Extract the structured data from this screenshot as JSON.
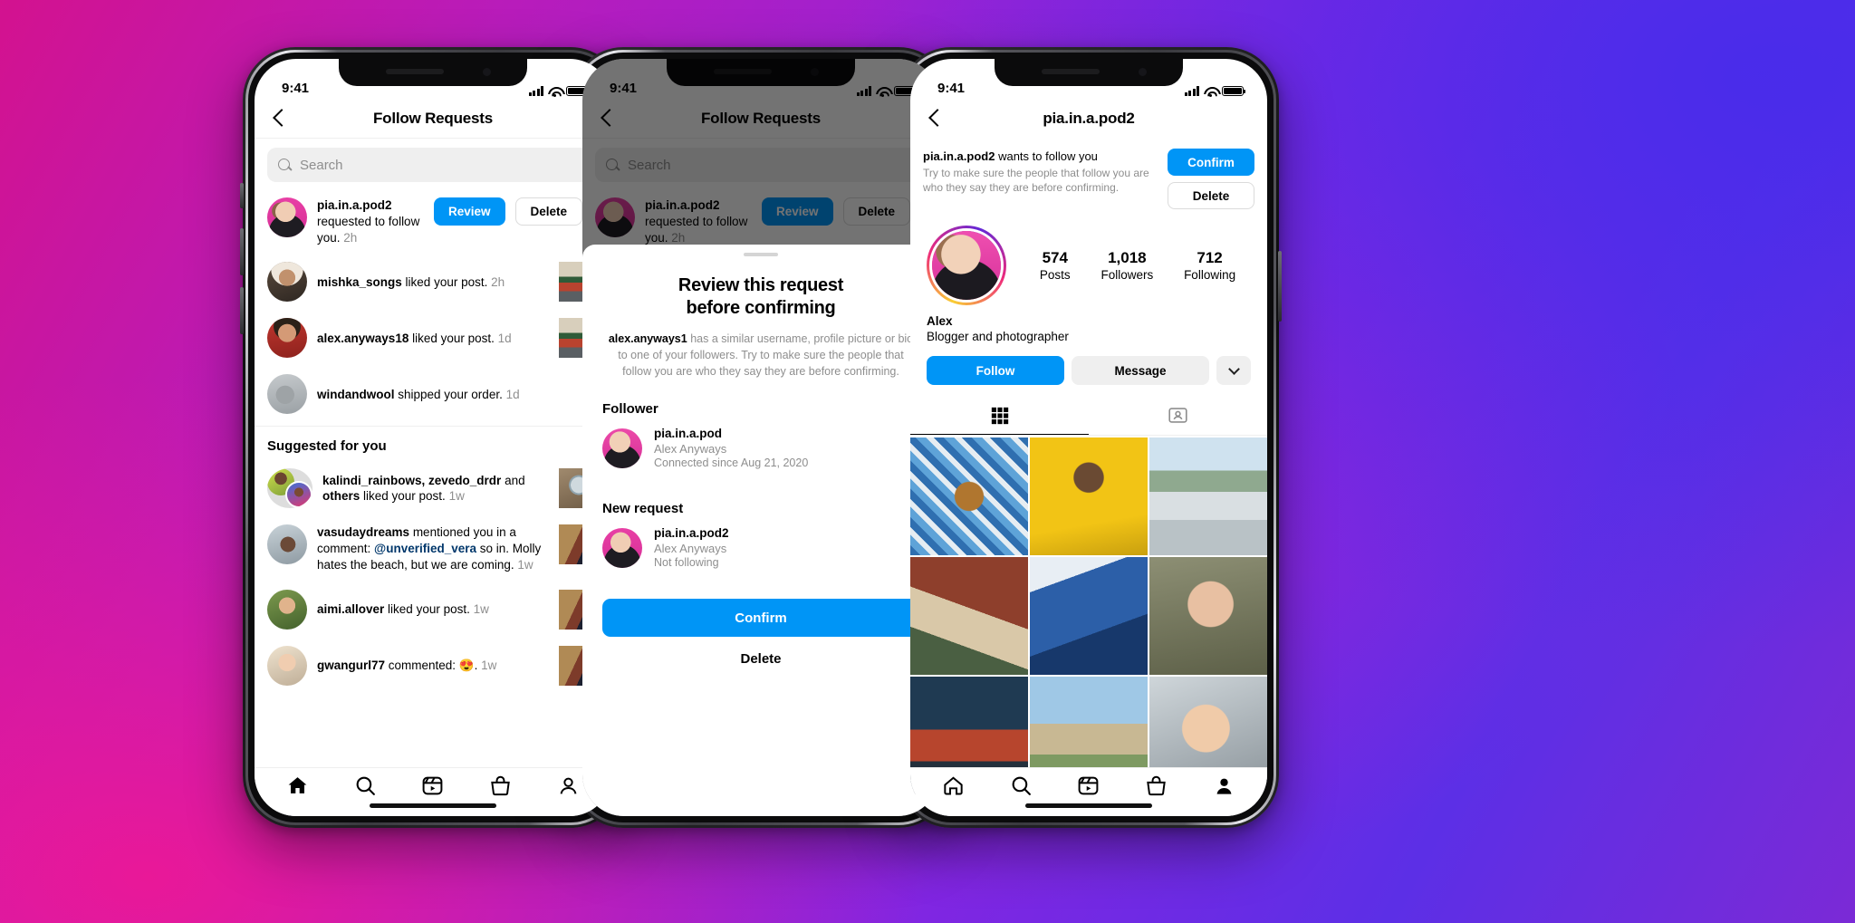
{
  "phones": [
    {
      "id": "phone-follow-requests",
      "status": {
        "time": "9:41"
      },
      "nav": {
        "title": "Follow Requests",
        "back_icon": "chevron-left-icon"
      },
      "search": {
        "placeholder": "Search",
        "icon": "search-icon"
      },
      "notifications": [
        {
          "user": "pia.in.a.pod2",
          "text": " requested to follow you.",
          "time": "2h",
          "actions": {
            "primary": "Review",
            "secondary": "Delete"
          },
          "avatar": "pia-avatar",
          "multiline": true
        },
        {
          "user": "mishka_songs",
          "text": " liked your post.",
          "time": "2h",
          "thumb": "post-thumb-storefront",
          "avatar": "mishka-avatar"
        },
        {
          "user": "alex.anyways18",
          "text": " liked your post.",
          "time": "1d",
          "thumb": "post-thumb-storefront",
          "avatar": "alex-avatar"
        },
        {
          "user": "windandwool",
          "text": " shipped your order.",
          "time": "1d",
          "avatar": "windandwool-avatar"
        }
      ],
      "section_title": "Suggested for you",
      "suggested": [
        {
          "user": "kalindi_rainbows, zevedo_drdr",
          "mid": " and ",
          "user2": "others",
          "text": " liked your post.",
          "time": "1w",
          "thumb": "post-thumb-ceramic",
          "avatar": "kalindi-avatar-pair"
        },
        {
          "user": "vasudaydreams",
          "text": " mentioned you in a comment: ",
          "mention": "@unverified_vera",
          "text2": " so in. Molly hates the beach, but we are coming.",
          "time": "1w",
          "thumb": "post-thumb-portrait",
          "avatar": "vasu-avatar"
        },
        {
          "user": "aimi.allover",
          "text": " liked your post.",
          "time": "1w",
          "thumb": "post-thumb-portrait",
          "avatar": "aimi-avatar"
        },
        {
          "user": "gwangurl77",
          "text": " commented: 😍.",
          "time": "1w",
          "thumb": "post-thumb-portrait",
          "avatar": "gwangurl-avatar"
        }
      ],
      "tabbar": [
        "home-icon",
        "search-icon",
        "reels-icon",
        "shop-icon",
        "profile-icon"
      ]
    },
    {
      "id": "phone-review-sheet",
      "status": {
        "time": "9:41"
      },
      "nav": {
        "title": "Follow Requests",
        "back_icon": "chevron-left-icon"
      },
      "search": {
        "placeholder": "Search",
        "icon": "search-icon"
      },
      "behind": {
        "user": "pia.in.a.pod2",
        "text": " requested to follow you.",
        "time": "2h",
        "actions": {
          "primary": "Review",
          "secondary": "Delete"
        }
      },
      "sheet": {
        "title_line1": "Review this request",
        "title_line2": "before confirming",
        "body_user": "alex.anyways1",
        "body_text": " has a similar username, profile picture or bio to one of your followers. Try to make sure the people that follow you are who they say they are before confirming.",
        "groups": [
          {
            "heading": "Follower",
            "username": "pia.in.a.pod",
            "name": "Alex Anyways",
            "detail": "Connected since Aug 21, 2020",
            "chevron": "chevron-right-icon"
          },
          {
            "heading": "New request",
            "username": "pia.in.a.pod2",
            "name": "Alex Anyways",
            "detail": "Not following",
            "chevron": "chevron-right-icon"
          }
        ],
        "confirm_label": "Confirm",
        "delete_label": "Delete"
      }
    },
    {
      "id": "phone-profile",
      "status": {
        "time": "9:41"
      },
      "nav": {
        "title": "pia.in.a.pod2",
        "back_icon": "chevron-left-icon"
      },
      "request_banner": {
        "user": "pia.in.a.pod2",
        "text": " wants to follow you",
        "sub": "Try to make sure the people that follow you are who they say they are before confirming.",
        "confirm_label": "Confirm",
        "delete_label": "Delete"
      },
      "stats": [
        {
          "value": "574",
          "label": "Posts"
        },
        {
          "value": "1,018",
          "label": "Followers"
        },
        {
          "value": "712",
          "label": "Following"
        }
      ],
      "bio": {
        "name": "Alex",
        "description": "Blogger and photographer"
      },
      "actions": {
        "follow": "Follow",
        "message": "Message",
        "more_icon": "chevron-down-icon"
      },
      "tabs": [
        {
          "icon": "grid-icon",
          "active": true
        },
        {
          "icon": "tagged-icon",
          "active": false
        }
      ],
      "tabbar": [
        "home-icon",
        "search-icon",
        "reels-icon",
        "shop-icon",
        "profile-icon"
      ]
    }
  ],
  "colors": {
    "accent_blue": "#0095f6",
    "muted_grey": "#8e8e8e",
    "divider": "#efefef",
    "chip_bg": "#efefef",
    "link_blue": "#00376b"
  }
}
